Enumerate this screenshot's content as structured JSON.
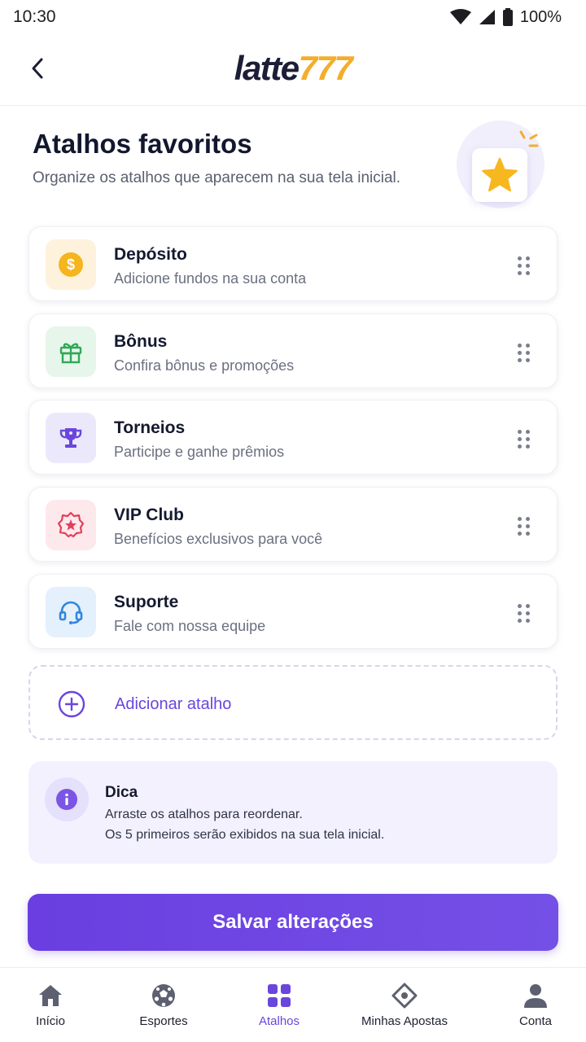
{
  "status_bar": {
    "time": "10:30",
    "battery": "100%"
  },
  "header": {
    "logo_part1": "latte",
    "logo_part2": "777"
  },
  "page": {
    "title": "Atalhos favoritos",
    "subtitle": "Organize os atalhos que aparecem na sua tela inicial."
  },
  "shortcuts": [
    {
      "name": "Depósito",
      "desc": "Adicione fundos na sua conta",
      "icon": "coin-icon",
      "color": "#f5b51f"
    },
    {
      "name": "Bônus",
      "desc": "Confira bônus e promoções",
      "icon": "gift-icon",
      "color": "#2fa857"
    },
    {
      "name": "Torneios",
      "desc": "Participe e ganhe prêmios",
      "icon": "trophy-icon",
      "color": "#6a46dc"
    },
    {
      "name": "VIP Club",
      "desc": "Benefícios exclusivos para você",
      "icon": "vip-badge-icon",
      "color": "#e0405a"
    },
    {
      "name": "Suporte",
      "desc": "Fale com nossa equipe",
      "icon": "headset-icon",
      "color": "#2f86e0"
    }
  ],
  "add_shortcut": {
    "label": "Adicionar atalho"
  },
  "tip": {
    "title": "Dica",
    "line1": "Arraste os atalhos para reordenar.",
    "line2": "Os 5 primeiros serão exibidos na sua tela inicial."
  },
  "save_button": {
    "label": "Salvar alterações"
  },
  "bottom_nav": [
    {
      "label": "Início",
      "icon": "home-icon",
      "active": false
    },
    {
      "label": "Esportes",
      "icon": "soccer-ball-icon",
      "active": false
    },
    {
      "label": "Atalhos",
      "icon": "grid-icon",
      "active": true
    },
    {
      "label": "Minhas Apostas",
      "icon": "ticket-icon",
      "active": false
    },
    {
      "label": "Conta",
      "icon": "user-icon",
      "active": false
    }
  ],
  "colors": {
    "accent": "#6a46dc",
    "brand_gold": "#f4ad2c",
    "text_dark": "#14192f"
  }
}
